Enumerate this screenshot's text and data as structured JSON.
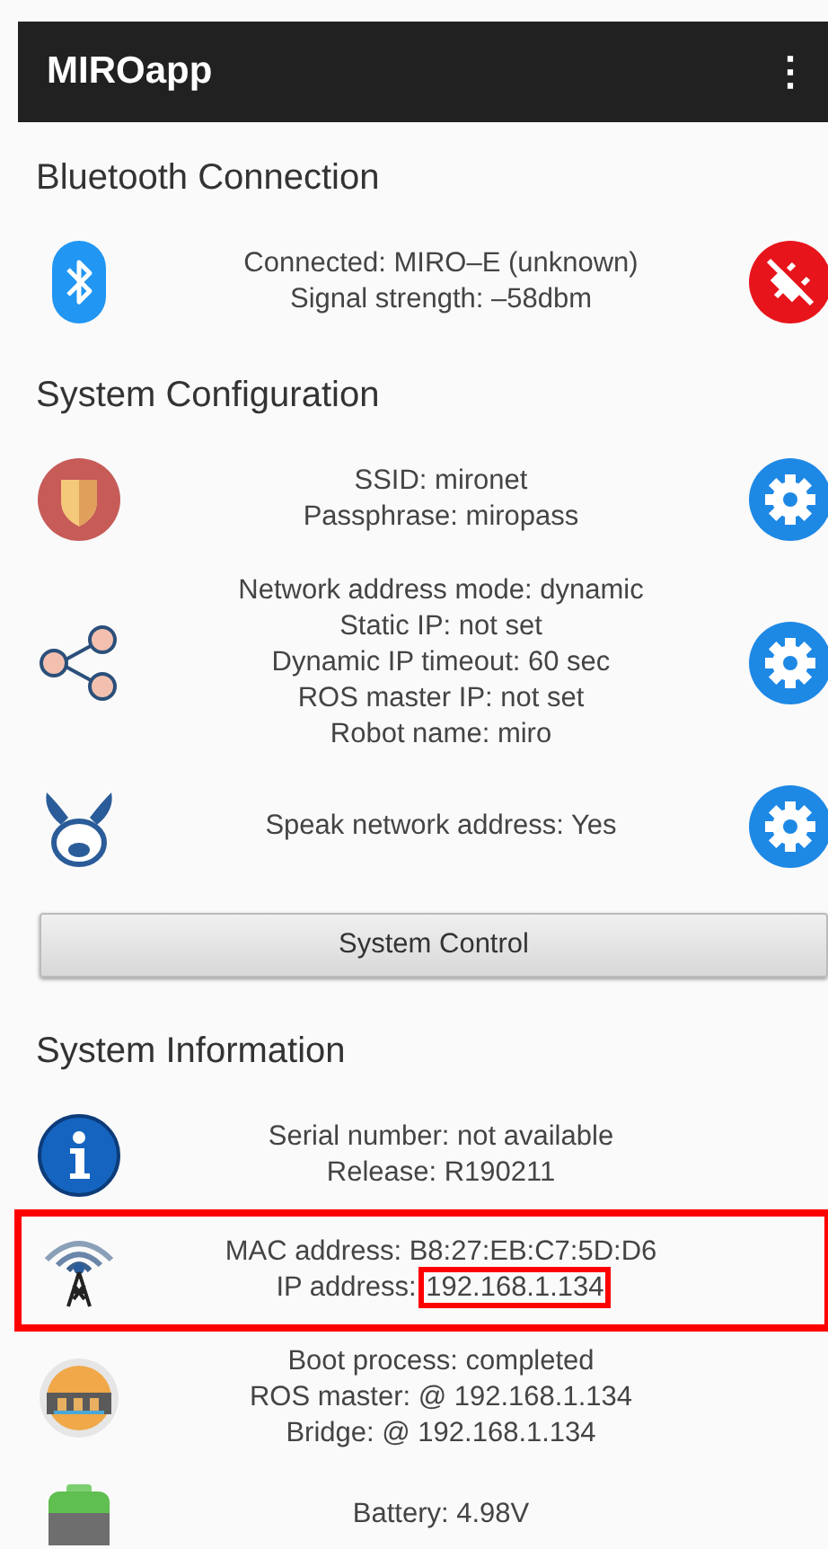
{
  "app_bar": {
    "title": "MIROapp",
    "menu": "⋮"
  },
  "sections": [
    {
      "title": "Bluetooth Connection",
      "rows": [
        {
          "lines": [
            "Connected: MIRO–E (unknown)",
            "Signal strength: –58dbm"
          ],
          "kind": "disconnect",
          "highlighted": false
        }
      ]
    },
    {
      "title": "System Configuration",
      "rows": [
        {
          "lines": [
            "SSID: mironet",
            "Passphrase: miropass"
          ],
          "kind": "settings",
          "highlighted": false
        },
        {
          "lines": [
            "Network address mode: dynamic",
            "Static IP: not set",
            "Dynamic IP timeout: 60 sec",
            "ROS master IP: not set",
            "Robot name: miro"
          ],
          "kind": "settings",
          "highlighted": false
        },
        {
          "lines": [
            "Speak network address: Yes"
          ],
          "kind": "settings",
          "highlighted": false
        }
      ],
      "button": "System Control"
    },
    {
      "title": "System Information",
      "rows": [
        {
          "lines": [
            "Serial number: not available",
            "Release: R190211"
          ],
          "highlighted": false
        },
        {
          "lines": [
            "MAC address: B8:27:EB:C7:5D:D6",
            [
              {
                "text": "IP address:",
                "boxed": false
              },
              {
                "text": "192.168.1.134",
                "boxed": true
              }
            ]
          ],
          "highlighted": true
        },
        {
          "lines": [
            "Boot process: completed",
            "ROS master: @ 192.168.1.134",
            "Bridge: @ 192.168.1.134"
          ],
          "highlighted": false
        },
        {
          "lines": [
            "Battery: 4.98V"
          ],
          "highlighted": false
        }
      ]
    }
  ]
}
